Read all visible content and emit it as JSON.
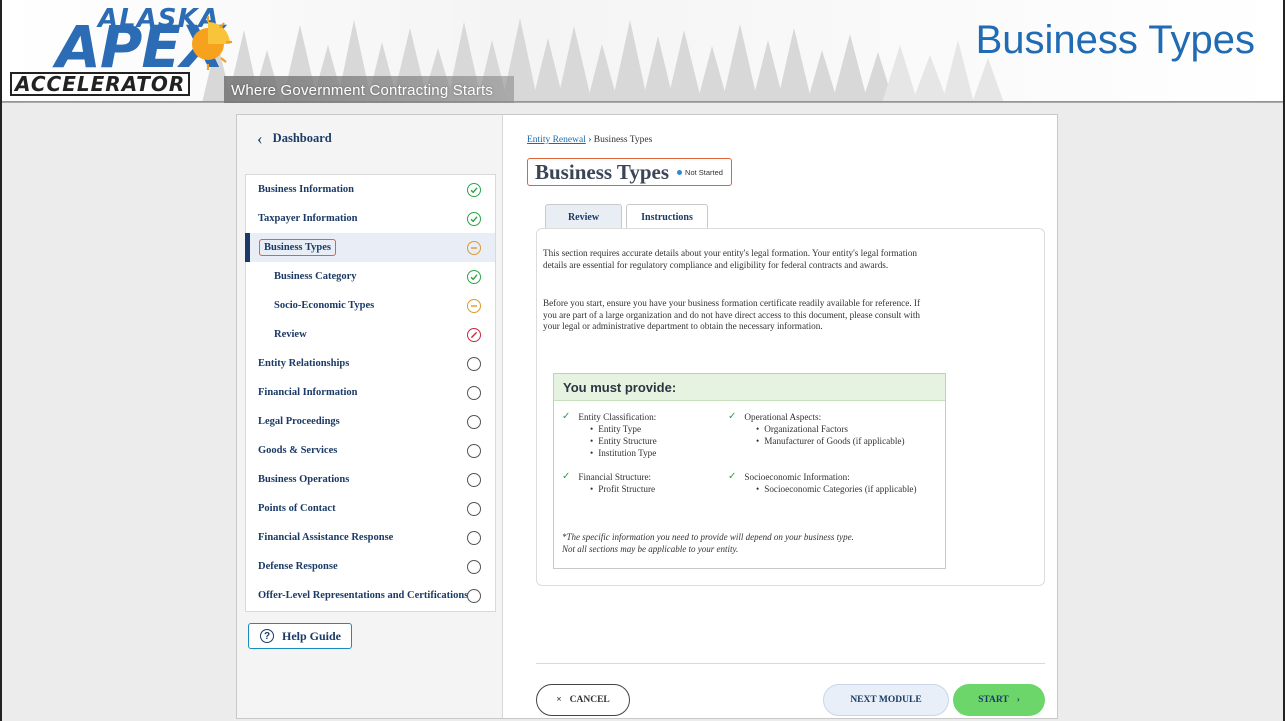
{
  "banner": {
    "logo": {
      "line1": "ALASKA",
      "line2": "APEX",
      "line3": "ACCELERATOR"
    },
    "tagline": "Where Government Contracting Starts",
    "slide_title": "Business Types"
  },
  "sidebar": {
    "back_label": "Dashboard",
    "items": [
      {
        "label": "Business Information",
        "status": "complete"
      },
      {
        "label": "Taxpayer Information",
        "status": "complete"
      },
      {
        "label": "Business Types",
        "status": "in-progress"
      },
      {
        "label": "Business Category",
        "status": "complete"
      },
      {
        "label": "Socio-Economic Types",
        "status": "in-progress"
      },
      {
        "label": "Review",
        "status": "error"
      },
      {
        "label": "Entity Relationships",
        "status": "not-started"
      },
      {
        "label": "Financial Information",
        "status": "not-started"
      },
      {
        "label": "Legal Proceedings",
        "status": "not-started"
      },
      {
        "label": "Goods & Services",
        "status": "not-started"
      },
      {
        "label": "Business Operations",
        "status": "not-started"
      },
      {
        "label": "Points of Contact",
        "status": "not-started"
      },
      {
        "label": "Financial Assistance Response",
        "status": "not-started"
      },
      {
        "label": "Defense Response",
        "status": "not-started"
      },
      {
        "label": "Offer-Level Representations and Certifications",
        "status": "not-started"
      }
    ],
    "help_label": "Help Guide"
  },
  "main": {
    "breadcrumb": {
      "link": "Entity Renewal",
      "separator": "›",
      "current": "Business Types"
    },
    "title": "Business Types",
    "status_badge": "Not Started",
    "tabs": [
      {
        "label": "Review"
      },
      {
        "label": "Instructions"
      }
    ],
    "para1": "This section requires accurate details about your entity's legal formation. Your entity's legal formation details are essential for regulatory compliance and eligibility for federal contracts and awards.",
    "para2": "Before you start, ensure you have your business formation certificate readily available for reference. If you are part of a large organization and do not have direct access to this document, please consult with your legal or administrative department to obtain the necessary information.",
    "provide": {
      "heading": "You must provide:",
      "groups": [
        {
          "title": "Entity Classification:",
          "items": [
            "Entity Type",
            "Entity Structure",
            "Institution Type"
          ]
        },
        {
          "title": "Operational Aspects:",
          "items": [
            "Organizational Factors",
            "Manufacturer of Goods (if applicable)"
          ]
        },
        {
          "title": "Financial Structure:",
          "items": [
            "Profit Structure"
          ]
        },
        {
          "title": "Socioeconomic Information:",
          "items": [
            "Socioeconomic Categories (if applicable)"
          ]
        }
      ],
      "note": "*The specific information you need to provide will depend on your business type. Not all sections may be applicable to your entity."
    },
    "buttons": {
      "cancel": "CANCEL",
      "next": "NEXT MODULE",
      "start": "START"
    }
  },
  "colors": {
    "brand_blue": "#1f6bb4",
    "highlight_orange": "#e0643a",
    "complete_green": "#28a745",
    "partial_orange": "#e0972a",
    "error_red": "#c8283c",
    "start_green": "#6cd66b"
  }
}
